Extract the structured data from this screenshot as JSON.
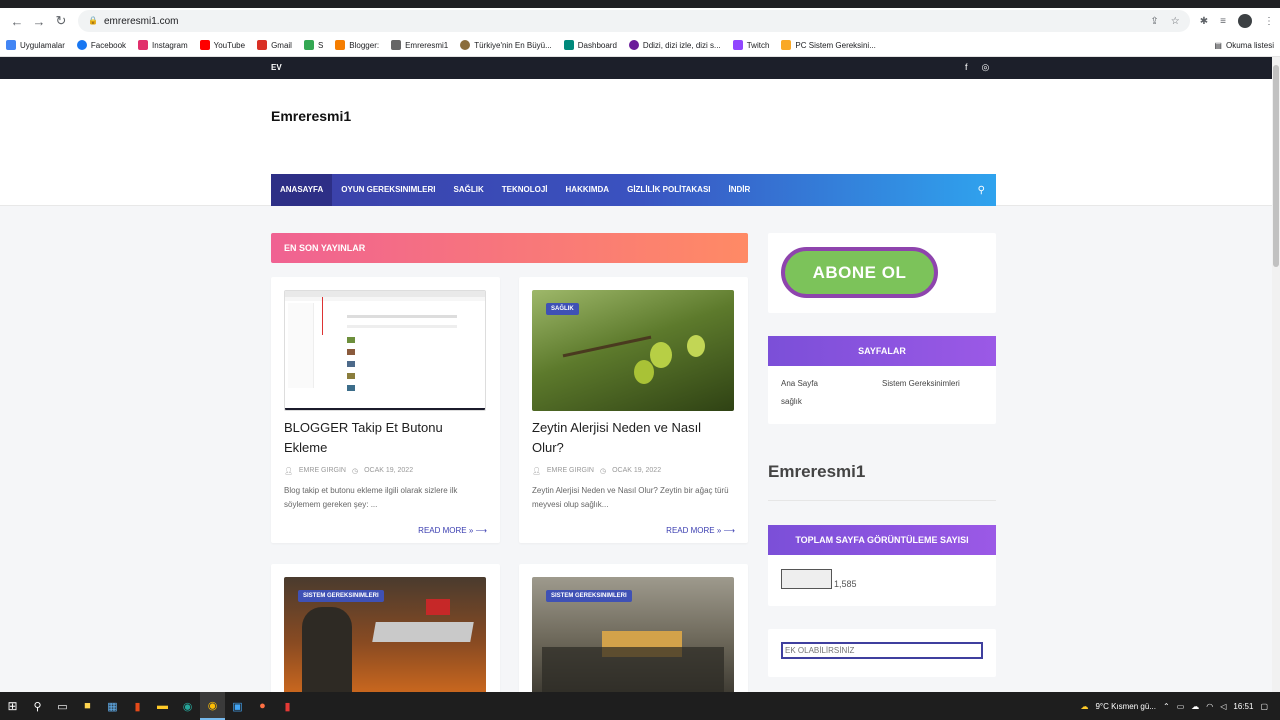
{
  "browser": {
    "url": "emreresmi1.com",
    "bookmarks": [
      {
        "label": "Uygulamalar",
        "color": "#4285f4"
      },
      {
        "label": "Facebook",
        "color": "#1877f2"
      },
      {
        "label": "Instagram",
        "color": "#e1306c"
      },
      {
        "label": "YouTube",
        "color": "#ff0000"
      },
      {
        "label": "Gmail",
        "color": "#d93025"
      },
      {
        "label": "S",
        "color": "#34a853"
      },
      {
        "label": "Blogger:",
        "color": "#f57d00"
      },
      {
        "label": "Emreresmi1",
        "color": "#666666"
      },
      {
        "label": "Türkiye'nin En Büyü...",
        "color": "#8a6d3b"
      },
      {
        "label": "Dashboard",
        "color": "#00897b"
      },
      {
        "label": "Ddizi, dizi izle, dizi s...",
        "color": "#6a1b9a"
      },
      {
        "label": "Twitch",
        "color": "#9146ff"
      },
      {
        "label": "PC Sistem Gereksini...",
        "color": "#f9a825"
      }
    ],
    "reading_list": "Okuma listesi"
  },
  "site": {
    "topbar_link": "EV",
    "logo": "Emreresmi1",
    "nav": [
      "ANASAYFA",
      "OYUN GEREKSINIMLERI",
      "SAĞLIK",
      "TEKNOLOJİ",
      "HAKKIMDA",
      "GİZLİLİK POLİTAKASI",
      "İNDİR"
    ],
    "latest_heading": "EN SON YAYINLAR",
    "posts": [
      {
        "title": "BLOGGER Takip Et Butonu Ekleme",
        "author": "EMRE GIRGIN",
        "date": "OCAK 19, 2022",
        "excerpt": "Blog takip et butonu ekleme  ilgili olarak sizlere ilk söylemem gereken şey: ...",
        "read_more": "READ MORE »",
        "tag": ""
      },
      {
        "title": "Zeytin Alerjisi Neden ve Nasıl Olur?",
        "author": "EMRE GIRGIN",
        "date": "OCAK 19, 2022",
        "excerpt": "Zeytin Alerjisi Neden ve Nasıl Olur? Zeytin bir ağaç türü meyvesi olup sağlık...",
        "read_more": "READ MORE »",
        "tag": "SAĞLIK"
      },
      {
        "tag": "SISTEM GEREKSINIMLERI"
      },
      {
        "tag": "SISTEM GEREKSINIMLERI"
      }
    ],
    "sidebar": {
      "subscribe_button": "ABONE OL",
      "pages_heading": "SAYFALAR",
      "pages": [
        "Ana Sayfa",
        "Sistem Gereksinimleri",
        "sağlık"
      ],
      "big_title": "Emreresmi1",
      "pageviews_heading": "TOPLAM SAYFA GÖRÜNTÜLEME SAYISI",
      "pageviews": "1,585",
      "input_placeholder": "EK OLABİLİRSİNİZ"
    }
  },
  "taskbar": {
    "weather": "9°C  Kısmen gü...",
    "time": "16:51"
  }
}
